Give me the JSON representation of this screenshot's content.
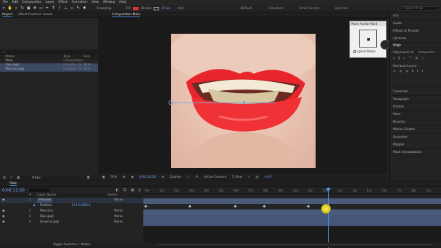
{
  "menu": [
    "File",
    "Edit",
    "Composition",
    "Layer",
    "Effect",
    "Animation",
    "View",
    "Window",
    "Help"
  ],
  "toolbar": {
    "snapping": "Snapping",
    "fill_label": "Fill:",
    "stroke_label": "Stroke:",
    "stroke_px": "10 px",
    "add_label": "Add:",
    "workspaces": [
      "Default",
      "Standard",
      "Small Screen",
      "Libraries"
    ],
    "search_placeholder": "Search Help"
  },
  "project_panel": {
    "tabs": [
      "Project",
      "Effect Controls: Sweet"
    ],
    "columns": [
      "Name",
      "Type",
      "Size"
    ],
    "items": [
      {
        "name": "Main",
        "type": "Composition",
        "size": ""
      },
      {
        "name": "[lips.jpg]",
        "type": "Importe...G",
        "size": "92.6"
      },
      {
        "name": "Mascara.jpg",
        "type": "Importe...G",
        "size": "56.6"
      }
    ],
    "footer_bpc": "8 bpc"
  },
  "composition": {
    "tab": "Composition Main",
    "sub_tab": "Main",
    "zoom": "50%",
    "timecode": "0:00:12:20",
    "resolution": "Quarter",
    "camera": "Active Camera",
    "views": "1 View",
    "exposure": "+0.0"
  },
  "puppet_popup": {
    "title": "Move Anchor Point",
    "checkbox_label": "Ignore Masks"
  },
  "right_panel": {
    "top_items": [
      "Info",
      "Audio",
      "Effects & Presets",
      "Libraries"
    ],
    "align": {
      "title": "Align",
      "align_layers_to": "Align Layers to:",
      "align_value": "Composition",
      "distribute": "Distribute Layers:"
    },
    "bottom_items": [
      "Character",
      "Paragraph",
      "Tracker",
      "Paint",
      "Brushes",
      "Motion Sketch",
      "Smoother",
      "Wiggler",
      "Mask Interpolation"
    ]
  },
  "timeline": {
    "tab": "Main",
    "timecode": "0:00:12:20",
    "columns": [
      "#",
      "Layer Name",
      "Parent"
    ],
    "layers": [
      {
        "num": "1",
        "name": "Preview",
        "parent": "None"
      },
      {
        "num": "",
        "name": "Position",
        "parent": "119.0,588.0"
      },
      {
        "num": "2",
        "name": "Mascara",
        "parent": "None"
      },
      {
        "num": "3",
        "name": "[lips.jpg]",
        "parent": "None"
      },
      {
        "num": "4",
        "name": "[mascar.jpg]",
        "parent": "None"
      }
    ],
    "ruler": [
      "00s",
      "01s",
      "02s",
      "03s",
      "04s",
      "05s",
      "06s",
      "07s",
      "08s",
      "09s",
      "10s",
      "11s",
      "12s",
      "13s",
      "14s",
      "15s",
      "16s",
      "17s",
      "18s",
      "19s"
    ],
    "footer": "Toggle Switches / Modes"
  }
}
